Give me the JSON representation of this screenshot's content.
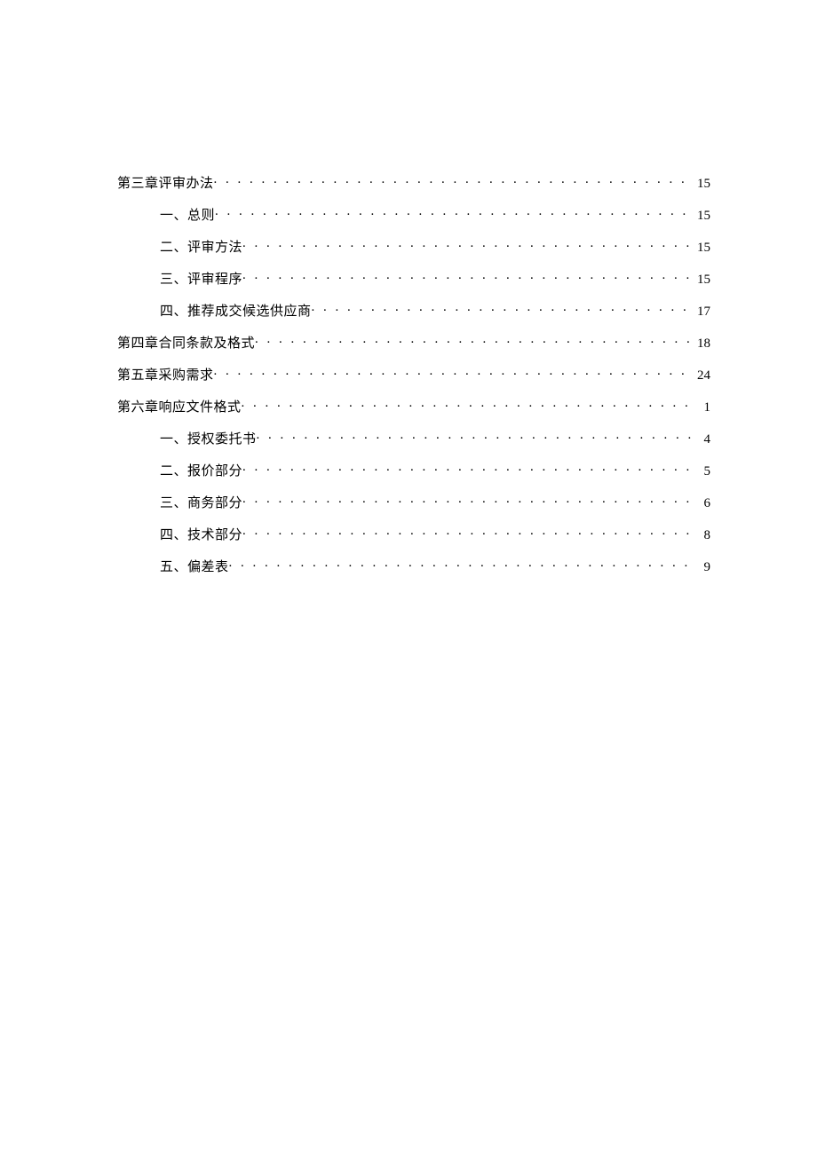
{
  "toc": [
    {
      "label": "第三章评审办法",
      "page": "15",
      "indent": false
    },
    {
      "label": "一、总则",
      "page": "15",
      "indent": true
    },
    {
      "label": "二、评审方法",
      "page": "15",
      "indent": true
    },
    {
      "label": "三、评审程序",
      "page": "15",
      "indent": true
    },
    {
      "label": "四、推荐成交候选供应商",
      "page": "17",
      "indent": true
    },
    {
      "label": "第四章合同条款及格式",
      "page": "18",
      "indent": false
    },
    {
      "label": "第五章采购需求",
      "page": "24",
      "indent": false
    },
    {
      "label": "第六章响应文件格式",
      "page": "1",
      "indent": false
    },
    {
      "label": "一、授权委托书",
      "page": "4",
      "indent": true
    },
    {
      "label": "二、报价部分",
      "page": "5",
      "indent": true
    },
    {
      "label": "三、商务部分",
      "page": "6",
      "indent": true
    },
    {
      "label": "四、技术部分",
      "page": "8",
      "indent": true
    },
    {
      "label": "五、偏差表",
      "page": "9",
      "indent": true
    }
  ]
}
